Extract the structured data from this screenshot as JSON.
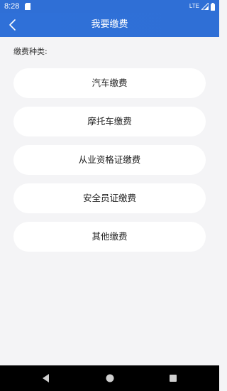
{
  "status_bar": {
    "time": "8:28",
    "network": "LTE",
    "icons": [
      "sd-card-icon",
      "signal-icon",
      "battery-icon"
    ]
  },
  "app_bar": {
    "title": "我要缴费",
    "back_icon": "chevron-left-icon"
  },
  "section": {
    "label": "缴费种类:"
  },
  "items": [
    {
      "label": "汽车缴费"
    },
    {
      "label": "摩托车缴费"
    },
    {
      "label": "从业资格证缴费"
    },
    {
      "label": "安全员证缴费"
    },
    {
      "label": "其他缴费"
    }
  ],
  "nav_bar": {
    "icons": [
      "back-triangle-icon",
      "home-circle-icon",
      "recents-square-icon"
    ]
  },
  "colors": {
    "primary": "#2f6fd6",
    "background": "#f4f4f6",
    "card": "#ffffff",
    "nav": "#000000"
  }
}
